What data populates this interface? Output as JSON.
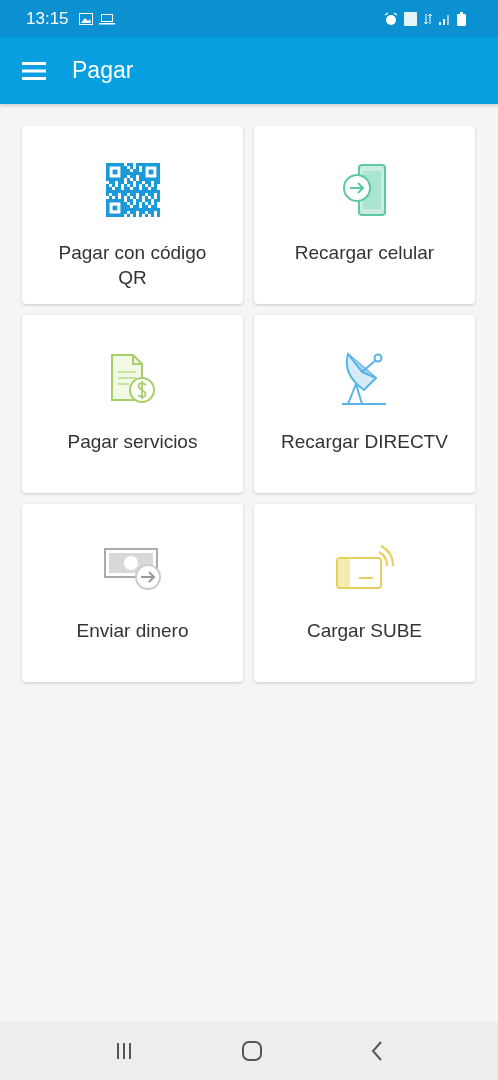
{
  "status_bar": {
    "time": "13:15"
  },
  "app_bar": {
    "title": "Pagar"
  },
  "tiles": [
    {
      "kind": "qr",
      "label": "Pagar con código QR"
    },
    {
      "kind": "phone",
      "label": "Recargar celular"
    },
    {
      "kind": "bill",
      "label": "Pagar servicios"
    },
    {
      "kind": "dish",
      "label": "Recargar DIRECTV"
    },
    {
      "kind": "money",
      "label": "Enviar dinero"
    },
    {
      "kind": "card",
      "label": "Cargar SUBE"
    }
  ]
}
